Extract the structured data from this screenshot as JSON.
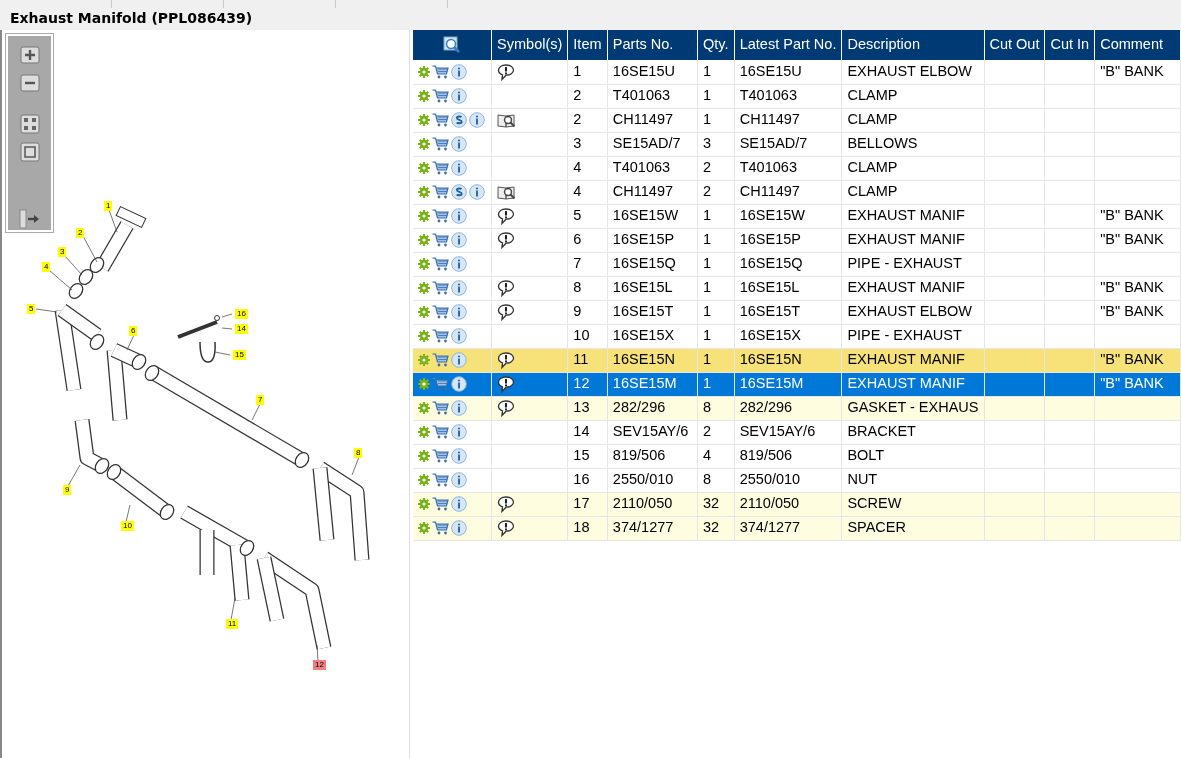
{
  "window": {
    "title": "Exhaust Manifold (PPL086439)"
  },
  "toolbar": [
    {
      "kind": "zoom-in"
    },
    {
      "kind": "zoom-out"
    },
    {
      "kind": "fit"
    },
    {
      "kind": "actual"
    },
    {
      "kind": "panel"
    }
  ],
  "callouts": [
    {
      "label": "1",
      "selected": false
    },
    {
      "label": "2",
      "selected": false
    },
    {
      "label": "3",
      "selected": false
    },
    {
      "label": "4",
      "selected": false
    },
    {
      "label": "5",
      "selected": false
    },
    {
      "label": "16",
      "selected": false
    },
    {
      "label": "14",
      "selected": false
    },
    {
      "label": "6",
      "selected": false
    },
    {
      "label": "15",
      "selected": false
    },
    {
      "label": "7",
      "selected": false
    },
    {
      "label": "8",
      "selected": false
    },
    {
      "label": "9",
      "selected": false
    },
    {
      "label": "10",
      "selected": false
    },
    {
      "label": "11",
      "selected": false
    },
    {
      "label": "12",
      "selected": true
    }
  ],
  "table": {
    "columns": [
      "Symbol(s)",
      "Item",
      "Parts No.",
      "Qty.",
      "Latest Part No.",
      "Description",
      "Cut Out",
      "Cut In",
      "Comment"
    ],
    "rows": [
      {
        "supersession": false,
        "note": true,
        "reference": false,
        "marked": false,
        "tinted": false,
        "item": "1",
        "part": "16SE15U",
        "qty": "1",
        "latest": "16SE15U",
        "description": "EXHAUST ELBOW",
        "comment": "\"B\" BANK",
        "selected": false
      },
      {
        "supersession": false,
        "note": false,
        "reference": false,
        "marked": false,
        "tinted": false,
        "item": "2",
        "part": "T401063",
        "qty": "1",
        "latest": "T401063",
        "description": "CLAMP",
        "selected": false
      },
      {
        "supersession": true,
        "note": false,
        "reference": true,
        "marked": false,
        "tinted": false,
        "item": "2",
        "part": "CH11497",
        "qty": "1",
        "latest": "CH11497",
        "description": "CLAMP",
        "selected": false
      },
      {
        "supersession": false,
        "note": false,
        "reference": false,
        "marked": false,
        "tinted": false,
        "item": "3",
        "part": "SE15AD/7",
        "qty": "3",
        "latest": "SE15AD/7",
        "description": "BELLOWS",
        "selected": false
      },
      {
        "supersession": false,
        "note": false,
        "reference": false,
        "marked": false,
        "tinted": false,
        "item": "4",
        "part": "T401063",
        "qty": "2",
        "latest": "T401063",
        "description": "CLAMP",
        "selected": false
      },
      {
        "supersession": true,
        "note": false,
        "reference": true,
        "marked": false,
        "tinted": false,
        "item": "4",
        "part": "CH11497",
        "qty": "2",
        "latest": "CH11497",
        "description": "CLAMP",
        "selected": false
      },
      {
        "supersession": false,
        "note": true,
        "reference": false,
        "marked": false,
        "tinted": false,
        "item": "5",
        "part": "16SE15W",
        "qty": "1",
        "latest": "16SE15W",
        "description": "EXHAUST MANIF",
        "comment": "\"B\" BANK",
        "selected": false
      },
      {
        "supersession": false,
        "note": true,
        "reference": false,
        "marked": false,
        "tinted": false,
        "item": "6",
        "part": "16SE15P",
        "qty": "1",
        "latest": "16SE15P",
        "description": "EXHAUST MANIF",
        "comment": "\"B\" BANK",
        "selected": false
      },
      {
        "supersession": false,
        "note": false,
        "reference": false,
        "marked": false,
        "tinted": false,
        "item": "7",
        "part": "16SE15Q",
        "qty": "1",
        "latest": "16SE15Q",
        "description": "PIPE - EXHAUST",
        "selected": false
      },
      {
        "supersession": false,
        "note": true,
        "reference": false,
        "marked": false,
        "tinted": false,
        "item": "8",
        "part": "16SE15L",
        "qty": "1",
        "latest": "16SE15L",
        "description": "EXHAUST MANIF",
        "comment": "\"B\" BANK",
        "selected": false
      },
      {
        "supersession": false,
        "note": true,
        "reference": false,
        "marked": false,
        "tinted": false,
        "item": "9",
        "part": "16SE15T",
        "qty": "1",
        "latest": "16SE15T",
        "description": "EXHAUST ELBOW",
        "comment": "\"B\" BANK",
        "selected": false
      },
      {
        "supersession": false,
        "note": false,
        "reference": false,
        "marked": false,
        "tinted": false,
        "item": "10",
        "part": "16SE15X",
        "qty": "1",
        "latest": "16SE15X",
        "description": "PIPE - EXHAUST",
        "selected": false
      },
      {
        "supersession": false,
        "note": true,
        "reference": false,
        "marked": true,
        "tinted": false,
        "item": "11",
        "part": "16SE15N",
        "qty": "1",
        "latest": "16SE15N",
        "description": "EXHAUST MANIF",
        "comment": "\"B\" BANK",
        "selected": false
      },
      {
        "supersession": false,
        "note": true,
        "reference": false,
        "marked": false,
        "tinted": false,
        "item": "12",
        "part": "16SE15M",
        "qty": "1",
        "latest": "16SE15M",
        "description": "EXHAUST MANIF",
        "comment": "\"B\" BANK",
        "selected": true
      },
      {
        "supersession": false,
        "note": true,
        "reference": false,
        "marked": false,
        "tinted": true,
        "item": "13",
        "part": "282/296",
        "qty": "8",
        "latest": "282/296",
        "description": "GASKET - EXHAUS",
        "selected": false
      },
      {
        "supersession": false,
        "note": false,
        "reference": false,
        "marked": false,
        "tinted": false,
        "item": "14",
        "part": "SEV15AY/6",
        "qty": "2",
        "latest": "SEV15AY/6",
        "description": "BRACKET",
        "selected": false
      },
      {
        "supersession": false,
        "note": false,
        "reference": false,
        "marked": false,
        "tinted": false,
        "item": "15",
        "part": "819/506",
        "qty": "4",
        "latest": "819/506",
        "description": "BOLT",
        "selected": false
      },
      {
        "supersession": false,
        "note": false,
        "reference": false,
        "marked": false,
        "tinted": false,
        "item": "16",
        "part": "2550/010",
        "qty": "8",
        "latest": "2550/010",
        "description": "NUT",
        "selected": false
      },
      {
        "supersession": false,
        "note": true,
        "reference": false,
        "marked": false,
        "tinted": true,
        "item": "17",
        "part": "2110/050",
        "qty": "32",
        "latest": "2110/050",
        "description": "SCREW",
        "selected": false
      },
      {
        "supersession": false,
        "note": true,
        "reference": false,
        "marked": false,
        "tinted": true,
        "item": "18",
        "part": "374/1277",
        "qty": "32",
        "latest": "374/1277",
        "description": "SPACER",
        "selected": false
      }
    ]
  }
}
